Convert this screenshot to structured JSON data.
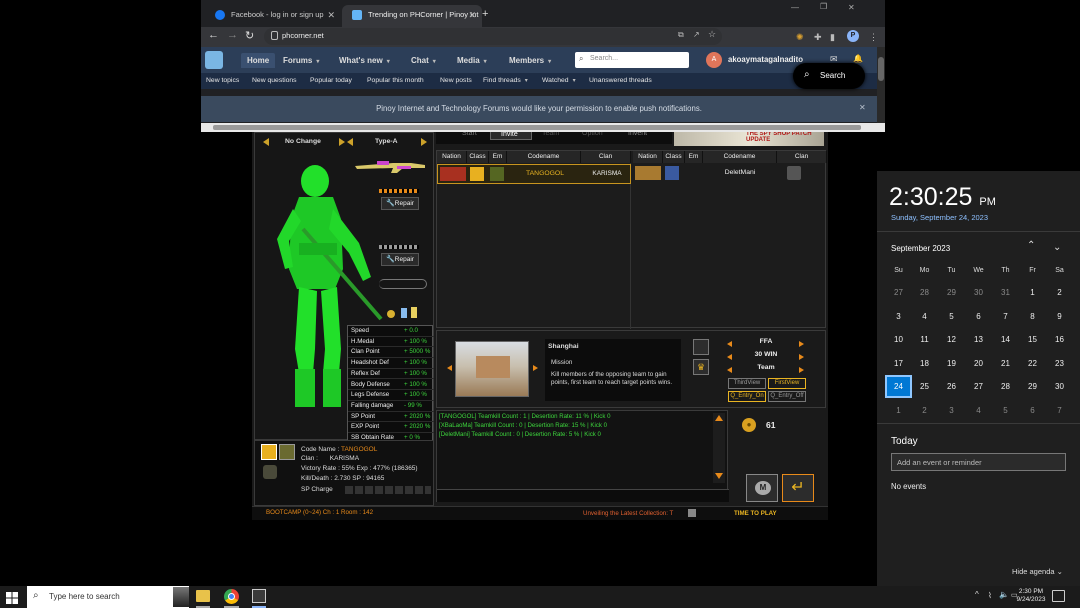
{
  "browser": {
    "tabs": [
      {
        "title": "Facebook - log in or sign up",
        "active": false
      },
      {
        "title": "Trending on PHCorner | Pinoy Int",
        "active": true
      }
    ],
    "new_tab": "+",
    "window_controls": {
      "minimize": "—",
      "restore": "❐",
      "close": "✕"
    },
    "url": "phcorner.net",
    "nav_back": "←",
    "nav_forward": "→",
    "nav_reload": "↻",
    "profile_letter": "P"
  },
  "site": {
    "nav": [
      {
        "label": "Home",
        "active": true,
        "caret": false
      },
      {
        "label": "Forums",
        "caret": true
      },
      {
        "label": "What's new",
        "caret": true
      },
      {
        "label": "Chat",
        "caret": true
      },
      {
        "label": "Media",
        "caret": true
      },
      {
        "label": "Members",
        "caret": true
      }
    ],
    "search_placeholder": "Search...",
    "user_name": "akoaymatagalnadito",
    "user_avatar_letter": "A",
    "search_button": "Search",
    "subnav": [
      {
        "label": "New topics"
      },
      {
        "label": "New questions"
      },
      {
        "label": "Popular today"
      },
      {
        "label": "Popular this month"
      },
      {
        "label": "New posts"
      },
      {
        "label": "Find threads",
        "caret": true
      },
      {
        "label": "Watched",
        "caret": true
      },
      {
        "label": "Unanswered threads"
      }
    ],
    "notification": "Pinoy Internet and Technology Forums would like your permission to enable push notifications.",
    "notification_close": "✕"
  },
  "game": {
    "selector_left": "No Change",
    "selector_right": "Type-A",
    "repair_label": "Repair",
    "stats": [
      {
        "k": "Speed",
        "v": "+ 0.0"
      },
      {
        "k": "H.Medal",
        "v": "+ 100 %"
      },
      {
        "k": "Clan Point",
        "v": "+ 5000 %"
      },
      {
        "k": "Headshot Def",
        "v": "+ 100 %"
      },
      {
        "k": "Reflex Def",
        "v": "+ 100 %"
      },
      {
        "k": "Body Defense",
        "v": "+ 100 %"
      },
      {
        "k": "Legs Defense",
        "v": "+ 100 %"
      },
      {
        "k": "Falling damage",
        "v": "- 99 %"
      },
      {
        "k": "SP Point",
        "v": "+ 2020 %"
      },
      {
        "k": "EXP Point",
        "v": "+ 2020 %"
      },
      {
        "k": "SB Obtain Rate",
        "v": "+ 0 %"
      }
    ],
    "profile": {
      "codename_label": "Code Name :",
      "codename": "TANGOGOL",
      "clan_label": "Clan :",
      "clan": "KARISMA",
      "victory": "Victory Rate : 55%   Exp : 477% (186365)",
      "kd": "Kill/Death : 2.730    SP : 94165",
      "sp_charge": "SP Charge"
    },
    "table_headers": [
      "Nation",
      "Class",
      "Em",
      "Codename",
      "Clan"
    ],
    "left_team": [
      {
        "codename": "TANGOGOL",
        "clan": "KARISMA"
      }
    ],
    "right_team": [
      {
        "codename": "DeletMani",
        "clan": ""
      }
    ],
    "map": {
      "name": "Shanghai",
      "mission_label": "Mission",
      "mission": "Kill members of the opposing team to gain points, first team to reach target points wins."
    },
    "modes": {
      "mode": "FFA",
      "win": "30 WIN",
      "team": "Team"
    },
    "views": {
      "third": "ThirdView",
      "first": "FirstView",
      "entry_on": "Q_Entry_On",
      "entry_off": "Q_Entry_Off"
    },
    "chat": [
      "[TANGOGOL] Teamkill Count : 1 | Desertion Rate: 11 % | Kick 0",
      "[XBaLaoMa] Teamkill Count : 0 | Desertion Rate: 15 % | Kick 0",
      "[DeletMani] Teamkill Count : 0 | Desertion Rate: 5 % | Kick 0"
    ],
    "coins": "61",
    "footer_left": "BOOTCAMP (0~24)   Ch : 1   Room : 142",
    "footer_mid": "Unveiling the Latest Collection: T",
    "footer_right": "TIME TO PLAY",
    "top_buttons": [
      "Start",
      "Invite",
      "Team",
      "Option",
      "Invent"
    ],
    "banner": "THE SPY SHOP PATCH UPDATE"
  },
  "calendar": {
    "time": "2:30:25",
    "ampm": "PM",
    "date_long": "Sunday, September 24, 2023",
    "month_title": "September 2023",
    "weekdays": [
      "Su",
      "Mo",
      "Tu",
      "We",
      "Th",
      "Fr",
      "Sa"
    ],
    "weeks": [
      [
        "27",
        "28",
        "29",
        "30",
        "31",
        "1",
        "2"
      ],
      [
        "3",
        "4",
        "5",
        "6",
        "7",
        "8",
        "9"
      ],
      [
        "10",
        "11",
        "12",
        "13",
        "14",
        "15",
        "16"
      ],
      [
        "17",
        "18",
        "19",
        "20",
        "21",
        "22",
        "23"
      ],
      [
        "24",
        "25",
        "26",
        "27",
        "28",
        "29",
        "30"
      ],
      [
        "1",
        "2",
        "3",
        "4",
        "5",
        "6",
        "7"
      ]
    ],
    "today_label": "Today",
    "event_placeholder": "Add an event or reminder",
    "no_events": "No events",
    "hide_agenda": "Hide agenda"
  },
  "taskbar": {
    "search_placeholder": "Type here to search",
    "clock_time": "2:30 PM",
    "clock_date": "9/24/2023",
    "tray_caret": "^"
  },
  "colors": {
    "accent": "#0078d4",
    "green": "#3dd63d",
    "gold": "#e9b422"
  }
}
